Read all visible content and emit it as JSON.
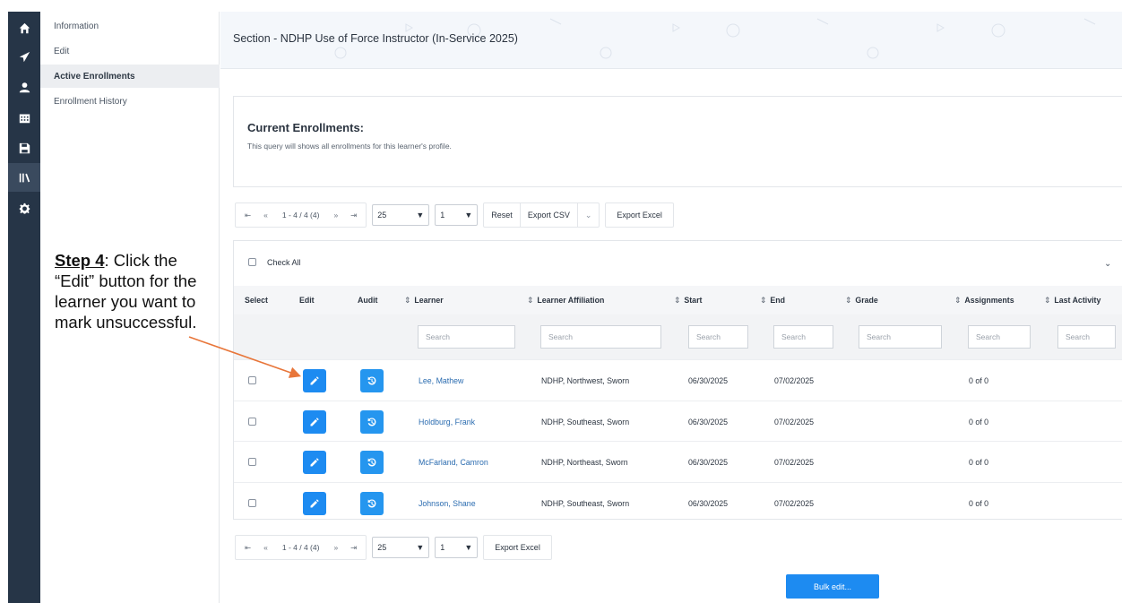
{
  "rail": {
    "icons": [
      "home-icon",
      "send-icon",
      "user-icon",
      "calendar-icon",
      "save-icon",
      "library-icon",
      "gear-icon"
    ],
    "active_index": 5
  },
  "subnav": {
    "items": [
      {
        "label": "Information"
      },
      {
        "label": "Edit"
      },
      {
        "label": "Active Enrollments"
      },
      {
        "label": "Enrollment History"
      }
    ],
    "active_index": 2
  },
  "annotation": {
    "step": "Step 4",
    "text": ": Click the “Edit” button for the learner you want to mark unsuccessful."
  },
  "header": {
    "title": "Section - NDHP Use of Force Instructor (In-Service 2025)"
  },
  "panel": {
    "title": "Current Enrollments:",
    "subtitle": "This query will shows all enrollments for this learner's profile."
  },
  "pager": {
    "first": "⇤",
    "prev": "«",
    "count": "1 - 4 / 4 (4)",
    "next": "»",
    "last": "⇥",
    "page_size": "25",
    "page": "1"
  },
  "toolbar": {
    "reset_label": "Reset",
    "export_csv_label": "Export CSV",
    "export_excel_label": "Export Excel"
  },
  "table": {
    "check_all_label": "Check All",
    "columns": {
      "select": "Select",
      "edit": "Edit",
      "audit": "Audit",
      "learner": "Learner",
      "affiliation": "Learner Affiliation",
      "start": "Start",
      "end": "End",
      "grade": "Grade",
      "assignments": "Assignments",
      "last_activity": "Last Activity"
    },
    "search_placeholder": "Search",
    "rows": [
      {
        "learner": "Lee, Mathew",
        "affiliation": "NDHP, Northwest, Sworn",
        "start": "06/30/2025",
        "end": "07/02/2025",
        "grade": "",
        "assignments": "0 of 0",
        "last_activity": ""
      },
      {
        "learner": "Holdburg, Frank",
        "affiliation": "NDHP, Southeast, Sworn",
        "start": "06/30/2025",
        "end": "07/02/2025",
        "grade": "",
        "assignments": "0 of 0",
        "last_activity": ""
      },
      {
        "learner": "McFarland, Camron",
        "affiliation": "NDHP, Northeast, Sworn",
        "start": "06/30/2025",
        "end": "07/02/2025",
        "grade": "",
        "assignments": "0 of 0",
        "last_activity": ""
      },
      {
        "learner": "Johnson, Shane",
        "affiliation": "NDHP, Southeast, Sworn",
        "start": "06/30/2025",
        "end": "07/02/2025",
        "grade": "",
        "assignments": "0 of 0",
        "last_activity": ""
      }
    ]
  },
  "bulk_edit_label": "Bulk edit...",
  "colors": {
    "rail": "#263547",
    "primary_button": "#1d8bf1",
    "link": "#2b6cb0",
    "arrow": "#e8763a"
  }
}
